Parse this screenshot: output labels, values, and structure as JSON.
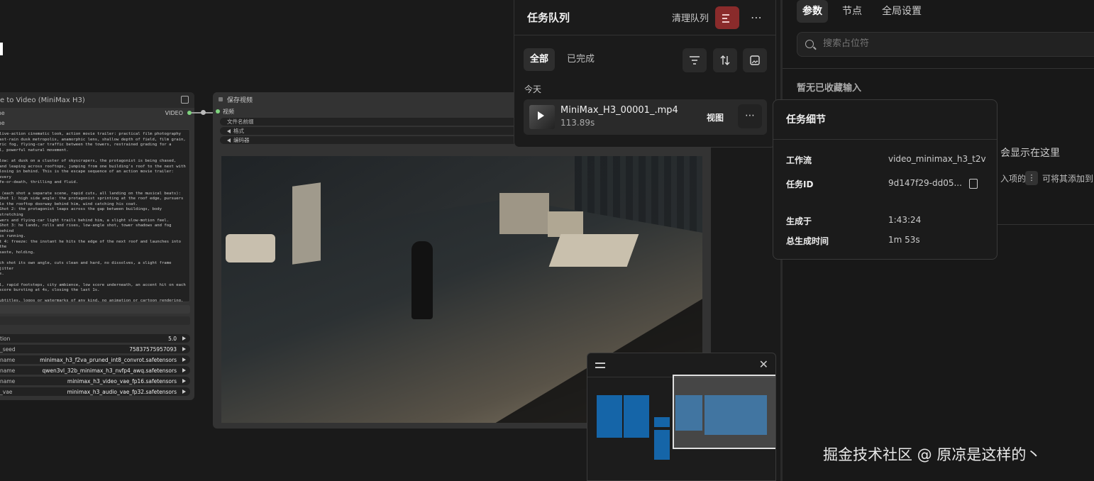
{
  "node_text_to_video": {
    "title": "e to Video (MiniMax H3)",
    "slot1": "me",
    "slot2": "me",
    "output_label": "VIDEO",
    "prompt": "live-action cinematic look, action movie trailer: practical film photography\nast-rain dusk metropolis, anamorphic lens, shallow depth of field, film grain,\nric fog, flying-car traffic between the towers, restrained grading for a\nl, powerful natural movement.\n\nlow: at dusk on a cluster of skyscrapers, the protagonist is being chased,\nand leaping across rooftops, jumping from one building's roof to the next with\nlosing in behind. This is the escape sequence of an action movie trailer: every\nfe-or-death, thrilling and fluid.\n\n (each shot a separate scene, rapid cuts, all landing on the musical beats):\nShot 1: high side angle: the protagonist sprinting at the roof edge, pursuers\nlo the rooftop doorway behind him, wind catching his coat.\nShot 2: the protagonist leaps across the gap between buildings, body stretching\nwers and flying-car light trails behind him, a slight slow-motion feel.\nShot 3: he lands, rolls and rises, low-angle shot, tower shadows and fog behind\nps running.\nt 4: freeze: the instant he hits the edge of the next roof and launches into the\nsaste, holding.\n\nch shot its own angle, cuts clean and hard, no dissolves, a slight frame jitter\ns.\n\nl, rapid footsteps, city ambience, low score underneath, an accent hit on each\nscore bursting at 4s, closing the last 1s.\n\nubtitles, logos or watermarks of any kind, no animation or cartoon rendering, no\nlook, keep the live-action texture.",
    "widgets": [
      {
        "label": "tion",
        "value": "5.0"
      },
      {
        "label": "_seed",
        "value": "75837575957093"
      },
      {
        "label": "name",
        "value": "minimax_h3_f2va_pruned_int8_convrot.safetensors"
      },
      {
        "label": "name",
        "value": "qwen3vl_32b_minimax_h3_nvfp4_awq.safetensors"
      },
      {
        "label": "name",
        "value": "minimax_h3_video_vae_fp16.safetensors"
      },
      {
        "label": "_vae",
        "value": "minimax_h3_audio_vae_fp32.safetensors"
      }
    ]
  },
  "node_save_video": {
    "title": "保存视频",
    "input_label": "视频",
    "widgets": [
      "文件名前缀",
      "格式",
      "编码器"
    ]
  },
  "task_queue": {
    "title": "任务队列",
    "clear_label": "清理队列",
    "more": "⋯",
    "tabs": [
      "全部",
      "已完成"
    ],
    "section": "今天",
    "item": {
      "name": "MiniMax_H3_00001_.mp4",
      "duration": "113.89s",
      "view_label": "视图",
      "more": "⋯"
    }
  },
  "task_detail": {
    "title": "任务细节",
    "rows": [
      {
        "label": "工作流",
        "value": "video_minimax_h3_t2v"
      },
      {
        "label": "任务ID",
        "value": "9d147f29-dd05..."
      },
      {
        "label": "生成于",
        "value": "1:43:24"
      },
      {
        "label": "总生成时间",
        "value": "1m 53s"
      }
    ]
  },
  "right_panel": {
    "tabs": [
      "参数",
      "节点",
      "全局设置"
    ],
    "search_placeholder": "搜索占位符",
    "empty_title": "暂无已收藏输入",
    "hint_line1": "会显示在这里",
    "hint_line2_a": "入项的",
    "hint_kebab": "⋮",
    "hint_line2_b": "可将其添加到"
  },
  "minimap": {
    "close": "✕"
  },
  "watermark": "掘金技术社区 @ 原凉是这样的丶"
}
